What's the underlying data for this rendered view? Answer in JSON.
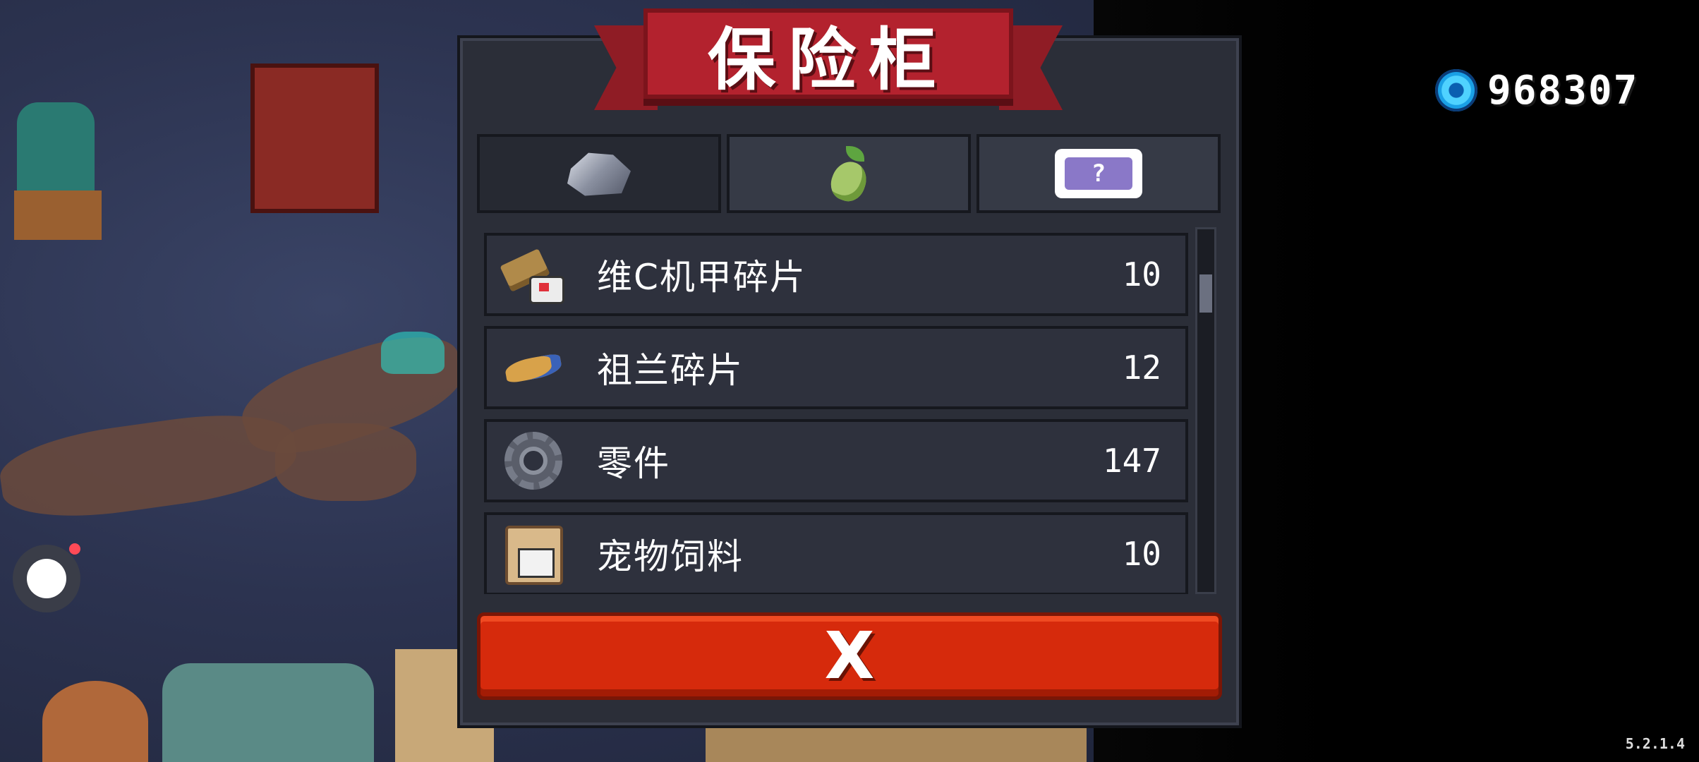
{
  "panel": {
    "title": "保险柜",
    "tabs": [
      {
        "icon": "ore-icon",
        "active": true
      },
      {
        "icon": "seed-icon",
        "active": false
      },
      {
        "icon": "ticket-icon",
        "ticket_text": "?"
      }
    ],
    "items": [
      {
        "name": "维C机甲碎片",
        "count": "10",
        "icon": "mecha-fragment-icon"
      },
      {
        "name": "祖兰碎片",
        "count": "12",
        "icon": "zulan-fragment-icon"
      },
      {
        "name": "零件",
        "count": "147",
        "icon": "gear-icon"
      },
      {
        "name": "宠物饲料",
        "count": "10",
        "icon": "pet-feed-icon"
      }
    ],
    "close_label": "X"
  },
  "currency": {
    "icon": "gem-icon",
    "value": "968307"
  },
  "version": "5.2.1.4"
}
